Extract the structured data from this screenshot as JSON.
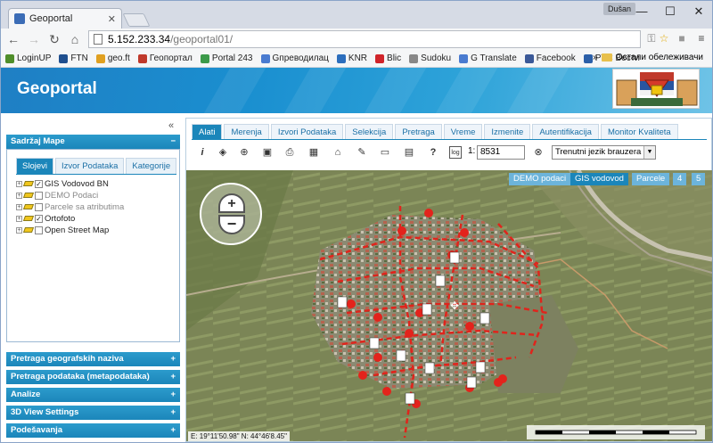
{
  "browser": {
    "tab_title": "Geoportal",
    "user_label": "Dušan",
    "url_host": "5.152.233.34",
    "url_path": "/geoportal01/",
    "bookmarks": [
      {
        "label": "LoginUP",
        "color": "#4f8e2a"
      },
      {
        "label": "FTN",
        "color": "#1f4f8f"
      },
      {
        "label": "geo.ft",
        "color": "#e0a020"
      },
      {
        "label": "Геопортал",
        "color": "#c0392b"
      },
      {
        "label": "Portal 243",
        "color": "#3c9a4a"
      },
      {
        "label": "Gпреводилац",
        "color": "#4a7bd0"
      },
      {
        "label": "KNR",
        "color": "#2c6ebd"
      },
      {
        "label": "Blic",
        "color": "#d0242a"
      },
      {
        "label": "Sudoku",
        "color": "#888888"
      },
      {
        "label": "G Translate",
        "color": "#4a7bd0"
      },
      {
        "label": "Facebook",
        "color": "#3b5998"
      },
      {
        "label": "PTC Вести",
        "color": "#2b5fa8"
      }
    ],
    "overflow_label": "»",
    "other_bookmarks": "Остали обележивачи"
  },
  "banner": {
    "title": "Geoportal"
  },
  "left": {
    "collapse": "«",
    "content_header": "Sadržaj Mape",
    "subtabs": [
      "Slojevi",
      "Izvor Podataka",
      "Kategorije"
    ],
    "layers": [
      {
        "label": "GIS Vodovod BN",
        "checked": "✓",
        "dim": false
      },
      {
        "label": "DEMO Podaci",
        "checked": "",
        "dim": true
      },
      {
        "label": "Parcele sa atributima",
        "checked": "",
        "dim": true
      },
      {
        "label": "Ortofoto",
        "checked": "✓",
        "dim": false
      },
      {
        "label": "Open Street Map",
        "checked": "",
        "dim": false
      }
    ],
    "panels": [
      "Pretraga geografskih naziva",
      "Pretraga podataka (metapodataka)",
      "Analize",
      "3D View Settings",
      "Podešavanja"
    ]
  },
  "main": {
    "tabs": [
      "Alati",
      "Merenja",
      "Izvori Podataka",
      "Selekcija",
      "Pretraga",
      "Vreme",
      "Izmenite",
      "Autentifikacija",
      "Monitor Kvaliteta"
    ],
    "scale_prefix": "1:",
    "scale_value": "8531",
    "language": "Trenutni jezik brauzera",
    "layer_buttons": [
      "DEMO podaci",
      "GIS vodovod",
      "Parcele",
      "4",
      "5"
    ],
    "coords": "E: 19°11'50.98\"   N: 44°46'8.45\""
  }
}
